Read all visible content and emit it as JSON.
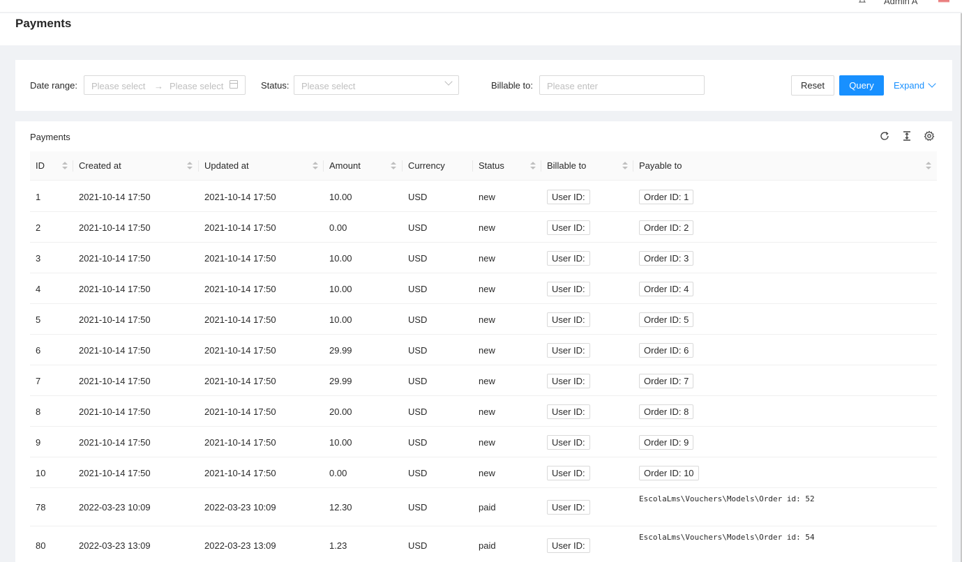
{
  "topbar": {
    "user_name": "Admin A",
    "bell_icon": "bell-icon",
    "flag_icon": "flag-icon"
  },
  "page": {
    "title": "Payments"
  },
  "filters": {
    "date_range_label": "Date range",
    "date_start_placeholder": "Please select",
    "date_end_placeholder": "Please select",
    "status_label": "Status",
    "status_placeholder": "Please select",
    "billable_label": "Billable to",
    "billable_placeholder": "Please enter",
    "reset_label": "Reset",
    "query_label": "Query",
    "expand_label": "Expand",
    "accent_color": "#1890ff"
  },
  "table": {
    "title": "Payments",
    "tools": [
      "reload-icon",
      "density-icon",
      "settings-icon"
    ],
    "columns": [
      "ID",
      "Created at",
      "Updated at",
      "Amount",
      "Currency",
      "Status",
      "Billable to",
      "Payable to"
    ],
    "rows": [
      {
        "id": "1",
        "created": "2021-10-14 17:50",
        "updated": "2021-10-14 17:50",
        "amount": "10.00",
        "currency": "USD",
        "status": "new",
        "billable": "User ID:",
        "payable": "Order ID: 1",
        "payable_tag": true
      },
      {
        "id": "2",
        "created": "2021-10-14 17:50",
        "updated": "2021-10-14 17:50",
        "amount": "0.00",
        "currency": "USD",
        "status": "new",
        "billable": "User ID:",
        "payable": "Order ID: 2",
        "payable_tag": true
      },
      {
        "id": "3",
        "created": "2021-10-14 17:50",
        "updated": "2021-10-14 17:50",
        "amount": "10.00",
        "currency": "USD",
        "status": "new",
        "billable": "User ID:",
        "payable": "Order ID: 3",
        "payable_tag": true
      },
      {
        "id": "4",
        "created": "2021-10-14 17:50",
        "updated": "2021-10-14 17:50",
        "amount": "10.00",
        "currency": "USD",
        "status": "new",
        "billable": "User ID:",
        "payable": "Order ID: 4",
        "payable_tag": true
      },
      {
        "id": "5",
        "created": "2021-10-14 17:50",
        "updated": "2021-10-14 17:50",
        "amount": "10.00",
        "currency": "USD",
        "status": "new",
        "billable": "User ID:",
        "payable": "Order ID: 5",
        "payable_tag": true
      },
      {
        "id": "6",
        "created": "2021-10-14 17:50",
        "updated": "2021-10-14 17:50",
        "amount": "29.99",
        "currency": "USD",
        "status": "new",
        "billable": "User ID:",
        "payable": "Order ID: 6",
        "payable_tag": true
      },
      {
        "id": "7",
        "created": "2021-10-14 17:50",
        "updated": "2021-10-14 17:50",
        "amount": "29.99",
        "currency": "USD",
        "status": "new",
        "billable": "User ID:",
        "payable": "Order ID: 7",
        "payable_tag": true
      },
      {
        "id": "8",
        "created": "2021-10-14 17:50",
        "updated": "2021-10-14 17:50",
        "amount": "20.00",
        "currency": "USD",
        "status": "new",
        "billable": "User ID:",
        "payable": "Order ID: 8",
        "payable_tag": true
      },
      {
        "id": "9",
        "created": "2021-10-14 17:50",
        "updated": "2021-10-14 17:50",
        "amount": "10.00",
        "currency": "USD",
        "status": "new",
        "billable": "User ID:",
        "payable": "Order ID: 9",
        "payable_tag": true
      },
      {
        "id": "10",
        "created": "2021-10-14 17:50",
        "updated": "2021-10-14 17:50",
        "amount": "0.00",
        "currency": "USD",
        "status": "new",
        "billable": "User ID:",
        "payable": "Order ID: 10",
        "payable_tag": true
      },
      {
        "id": "78",
        "created": "2022-03-23 10:09",
        "updated": "2022-03-23 10:09",
        "amount": "12.30",
        "currency": "USD",
        "status": "paid",
        "billable": "User ID:",
        "payable": "EscolaLms\\Vouchers\\Models\\Order id: 52",
        "payable_tag": false
      },
      {
        "id": "80",
        "created": "2022-03-23 13:09",
        "updated": "2022-03-23 13:09",
        "amount": "1.23",
        "currency": "USD",
        "status": "paid",
        "billable": "User ID:",
        "payable": "EscolaLms\\Vouchers\\Models\\Order id: 54",
        "payable_tag": false
      }
    ]
  }
}
